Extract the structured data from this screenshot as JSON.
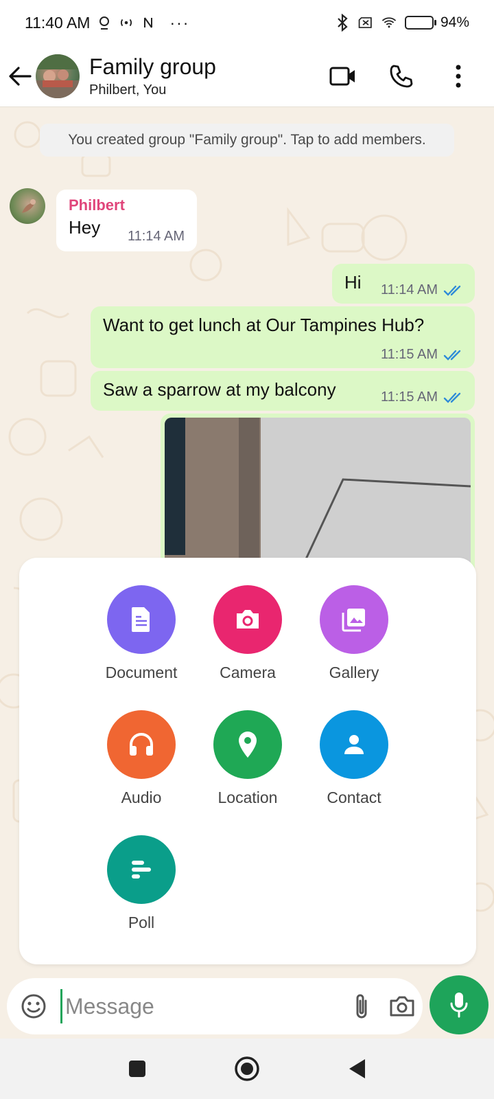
{
  "status_bar": {
    "time": "11:40 AM",
    "dots": "···",
    "battery": "94%",
    "battery_level": 0.94
  },
  "header": {
    "title": "Family group",
    "subtitle": "Philbert, You"
  },
  "chat": {
    "system_message": "You created group \"Family group\". Tap to add members.",
    "incoming": {
      "sender": "Philbert",
      "text": "Hey",
      "time": "11:14 AM"
    },
    "outgoing": [
      {
        "text": "Hi",
        "time": "11:14 AM"
      },
      {
        "text": "Want to get lunch at Our Tampines Hub?",
        "time": "11:15 AM"
      },
      {
        "text": "Saw a sparrow at my balcony",
        "time": "11:15 AM"
      }
    ]
  },
  "attach_menu": {
    "items": [
      {
        "label": "Document",
        "icon": "document-icon",
        "color": "#7d66f0"
      },
      {
        "label": "Camera",
        "icon": "camera-icon",
        "color": "#e9266f"
      },
      {
        "label": "Gallery",
        "icon": "gallery-icon",
        "color": "#bb5fe6"
      },
      {
        "label": "Audio",
        "icon": "headphones-icon",
        "color": "#f06632"
      },
      {
        "label": "Location",
        "icon": "location-pin-icon",
        "color": "#1fa855"
      },
      {
        "label": "Contact",
        "icon": "person-icon",
        "color": "#0a96df"
      },
      {
        "label": "Poll",
        "icon": "poll-icon",
        "color": "#0a9e8a"
      }
    ]
  },
  "input": {
    "placeholder": "Message"
  },
  "colors": {
    "accent": "#1ea45a",
    "outgoing_bubble": "#dcf8c6",
    "read_ticks": "#34b7f1",
    "sender_name": "#e0457a"
  }
}
